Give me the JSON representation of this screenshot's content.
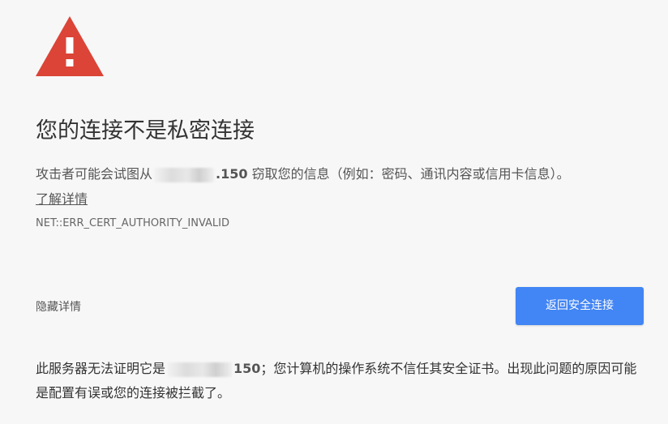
{
  "colors": {
    "background": "#f7f7f7",
    "warning_red": "#db4437",
    "button_blue": "#4285f4"
  },
  "warning_icon": {
    "name": "warning-triangle-icon",
    "glyph": "!"
  },
  "title": "您的连接不是私密连接",
  "message": {
    "before": "攻击者可能会试图从",
    "host_suffix": ".150",
    "after": " 窃取您的信息（例如：密码、通讯内容或信用卡信息）。"
  },
  "learn_more": "了解详情",
  "error_code": "NET::ERR_CERT_AUTHORITY_INVALID",
  "details_toggle": "隐藏详情",
  "primary_button": "返回安全连接",
  "details": {
    "before": "此服务器无法证明它是",
    "host_suffix": "150",
    "after": "；您计算机的操作系统不信任其安全证书。出现此问题的原因可能是配置有误或您的连接被拦截了。"
  }
}
